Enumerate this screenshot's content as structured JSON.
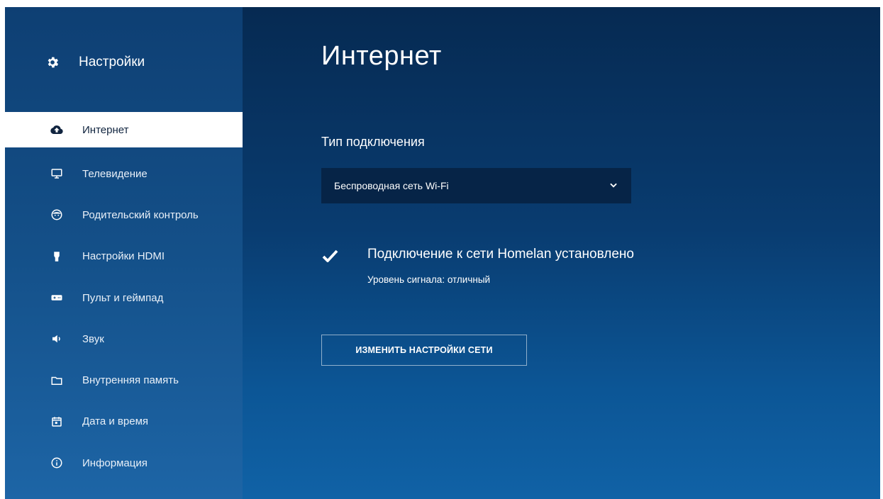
{
  "sidebar": {
    "title": "Настройки",
    "title_icon": "gear-icon",
    "items": [
      {
        "label": "Интернет",
        "icon": "cloud-upload-icon",
        "active": true
      },
      {
        "label": "Телевидение",
        "icon": "tv-icon"
      },
      {
        "label": "Родительский контроль",
        "icon": "child-face-icon"
      },
      {
        "label": "Настройки HDMI",
        "icon": "hdmi-plug-icon"
      },
      {
        "label": "Пульт и геймпад",
        "icon": "gamepad-icon"
      },
      {
        "label": "Звук",
        "icon": "speaker-icon"
      },
      {
        "label": "Внутренняя память",
        "icon": "folder-icon"
      },
      {
        "label": "Дата и время",
        "icon": "calendar-icon"
      },
      {
        "label": "Информация",
        "icon": "info-icon"
      }
    ]
  },
  "main": {
    "title": "Интернет",
    "connection_type_label": "Тип подключения",
    "connection_type_value": "Беспроводная сеть Wi-Fi",
    "status_title": "Подключение к сети Homelan установлено",
    "status_subtitle": "Уровень сигнала: отличный",
    "change_button_label": "ИЗМЕНИТЬ НАСТРОЙКИ СЕТИ"
  },
  "colors": {
    "accent_active_bg": "#ffffff",
    "sidebar_bg": "#145089",
    "main_bg": "#093c70",
    "dropdown_bg": "#062447"
  }
}
